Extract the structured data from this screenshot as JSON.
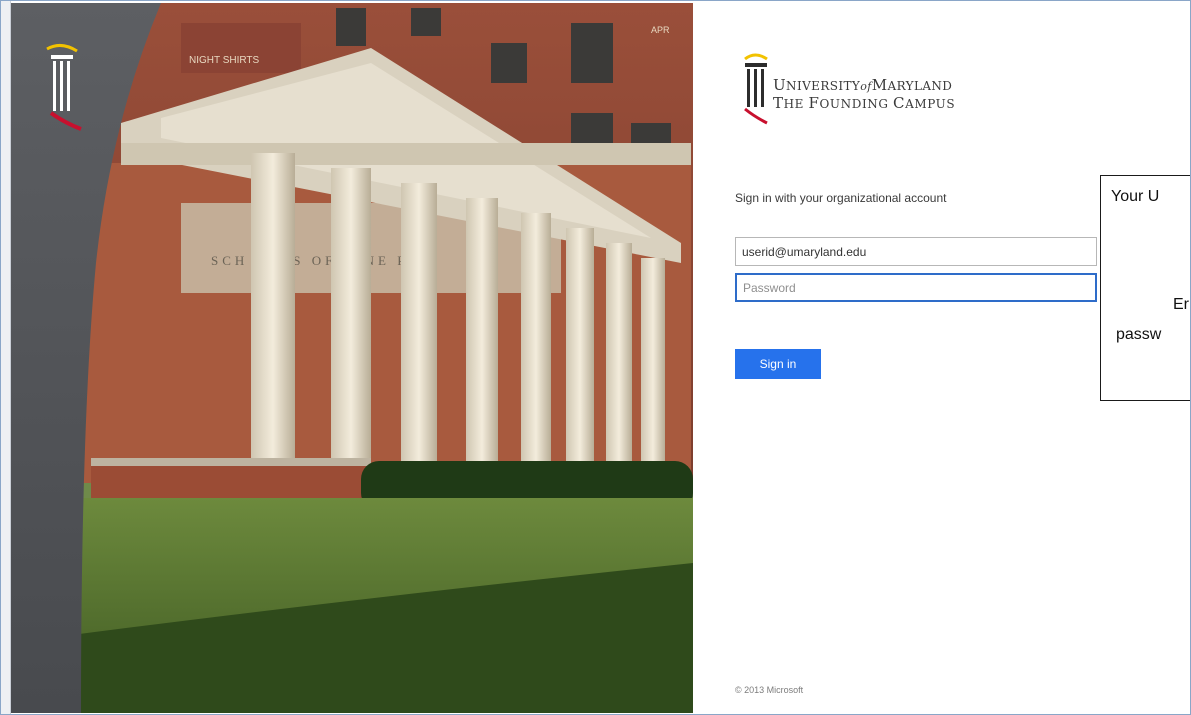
{
  "logo": {
    "line1_a": "U",
    "line1_b": "NIVERSITY",
    "line1_of": "of",
    "line1_c": "M",
    "line1_d": "ARYLAND",
    "line2_a": "T",
    "line2_b": "HE ",
    "line2_c": "F",
    "line2_d": "OUNDING ",
    "line2_e": "C",
    "line2_f": "AMPUS",
    "colors": {
      "gold": "#f2c200",
      "red": "#c8102e",
      "dark": "#2d2d2d"
    }
  },
  "signin": {
    "instruction": "Sign in with your organizational account",
    "username_value": "userid@umaryland.edu",
    "password_placeholder": "Password",
    "button_label": "Sign in",
    "button_color": "#2672ec"
  },
  "footer": {
    "copyright": "© 2013 Microsoft"
  },
  "callout": {
    "line1": "Your U",
    "line2": "Er",
    "line3": "passw"
  },
  "hero": {
    "building_sign_top": "NIGHT SHIRTS",
    "building_sign_letters": "SCH   VERS   OF   CINE   RY",
    "sign_corner": "APR"
  }
}
